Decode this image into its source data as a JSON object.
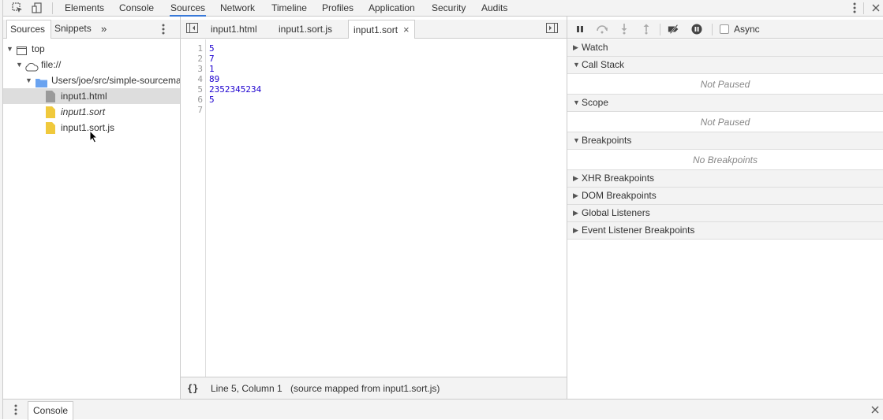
{
  "toolbar": {
    "inspect_icon": "inspect-icon",
    "device_icon": "device-mode-icon",
    "tabs": [
      "Elements",
      "Console",
      "Sources",
      "Network",
      "Timeline",
      "Profiles",
      "Application",
      "Security",
      "Audits"
    ],
    "active_tab": "Sources",
    "more_icon": "kebab-menu-icon",
    "close_icon": "close-icon"
  },
  "navigator": {
    "tabs": [
      "Sources",
      "Snippets"
    ],
    "more_tabs": "»",
    "tree": [
      {
        "label": "top",
        "icon": "frame-icon",
        "expanded": true
      },
      {
        "label": "file://",
        "icon": "cloud-icon",
        "expanded": true
      },
      {
        "label": "Users/joe/src/simple-sourcemap",
        "icon": "folder-icon",
        "expanded": true
      },
      {
        "label": "input1.html",
        "icon": "file-gray-icon",
        "selected": true
      },
      {
        "label": "input1.sort",
        "icon": "file-yellow-icon",
        "italic": true
      },
      {
        "label": "input1.sort.js",
        "icon": "file-yellow-icon"
      }
    ]
  },
  "editor": {
    "tabs": [
      {
        "label": "input1.html",
        "active": false
      },
      {
        "label": "input1.sort.js",
        "active": false
      },
      {
        "label": "input1.sort",
        "active": true,
        "closable": true
      }
    ],
    "lines": [
      "5",
      "7",
      "1",
      "89",
      "2352345234",
      "5",
      ""
    ],
    "status": {
      "format_icon": "{}",
      "position": "Line 5, Column 1",
      "mapping": "(source mapped from input1.sort.js)"
    }
  },
  "debugger": {
    "async_label": "Async",
    "async_checked": false,
    "panes": [
      {
        "title": "Watch",
        "expanded": false
      },
      {
        "title": "Call Stack",
        "expanded": true,
        "body": "Not Paused"
      },
      {
        "title": "Scope",
        "expanded": true,
        "body": "Not Paused"
      },
      {
        "title": "Breakpoints",
        "expanded": true,
        "body": "No Breakpoints"
      },
      {
        "title": "XHR Breakpoints",
        "expanded": false
      },
      {
        "title": "DOM Breakpoints",
        "expanded": false
      },
      {
        "title": "Global Listeners",
        "expanded": false
      },
      {
        "title": "Event Listener Breakpoints",
        "expanded": false
      }
    ]
  },
  "drawer": {
    "tab": "Console"
  },
  "colors": {
    "accent": "#3879d9",
    "code_number": "#1c00cf",
    "folder": "#6aa3f0",
    "js_file": "#f0c93c",
    "html_file": "#9a9a9a"
  }
}
